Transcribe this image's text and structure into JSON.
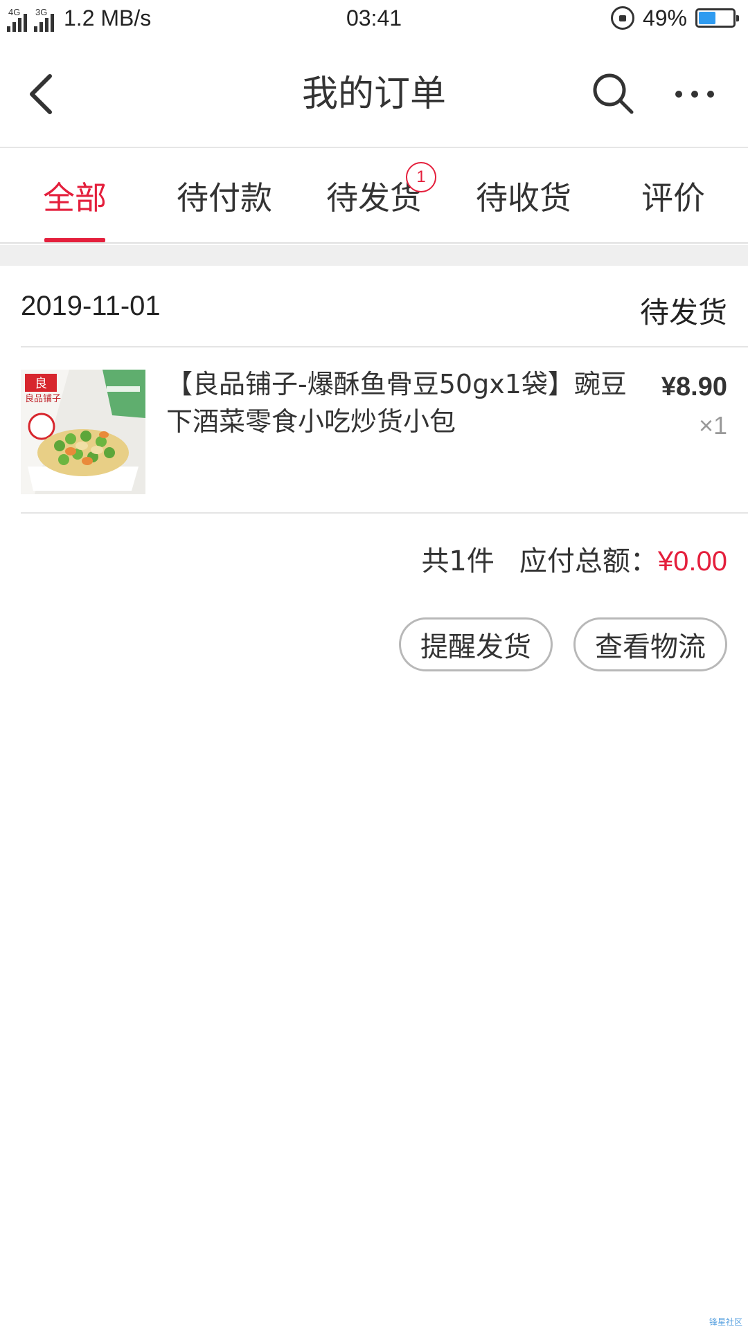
{
  "status_bar": {
    "net1": "4G",
    "net2": "3G",
    "speed": "1.2 MB/s",
    "time": "03:41",
    "battery": "49%",
    "battery_level": 0.49
  },
  "header": {
    "title": "我的订单"
  },
  "tabs": [
    {
      "label": "全部",
      "active": true
    },
    {
      "label": "待付款"
    },
    {
      "label": "待发货",
      "badge": "1"
    },
    {
      "label": "待收货"
    },
    {
      "label": "评价"
    }
  ],
  "order": {
    "date": "2019-11-01",
    "status": "待发货",
    "item": {
      "title": "【良品铺子-爆酥鱼骨豆50gx1袋】豌豆下酒菜零食小吃炒货小包",
      "price": "¥8.90",
      "qty": "×1",
      "thumb_brand": "良品铺子"
    },
    "count_text": "共1件",
    "total_label": "应付总额：",
    "total_value": "¥0.00",
    "buttons": {
      "remind": "提醒发货",
      "logistics": "查看物流"
    }
  },
  "watermark": "锋星社区",
  "colors": {
    "accent": "#e41f3c",
    "battery": "#2f9bf0"
  }
}
